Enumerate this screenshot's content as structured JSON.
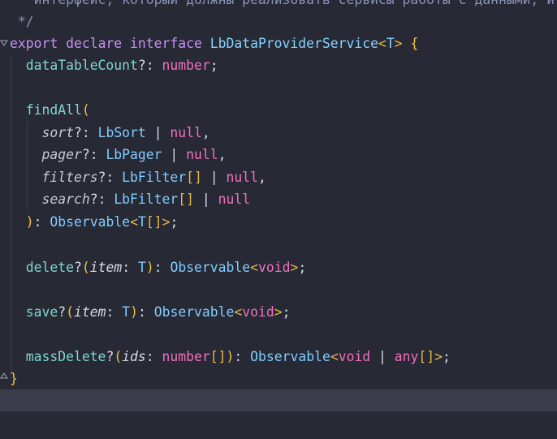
{
  "editor": {
    "lines": [
      {
        "t": "comment",
        "text": " * интерфейс, который должны реализовать сервисы работы с данными, и"
      },
      {
        "t": "comment",
        "text": " */"
      },
      {
        "t": "code",
        "parts": [
          [
            "kw",
            "export"
          ],
          [
            "punct",
            " "
          ],
          [
            "kw",
            "declare"
          ],
          [
            "punct",
            " "
          ],
          [
            "kw",
            "interface"
          ],
          [
            "punct",
            " "
          ],
          [
            "type",
            "LbDataProviderService"
          ],
          [
            "angle",
            "<"
          ],
          [
            "type",
            "T"
          ],
          [
            "angle",
            ">"
          ],
          [
            "punct",
            " "
          ],
          [
            "paren",
            "{"
          ]
        ]
      },
      {
        "t": "code",
        "parts": [
          [
            "punct",
            "  "
          ],
          [
            "fn",
            "dataTableCount"
          ],
          [
            "punct",
            "?: "
          ],
          [
            "num",
            "number"
          ],
          [
            "punct",
            ";"
          ]
        ]
      },
      {
        "t": "empty"
      },
      {
        "t": "code",
        "parts": [
          [
            "punct",
            "  "
          ],
          [
            "fn",
            "findAll"
          ],
          [
            "paren",
            "("
          ]
        ]
      },
      {
        "t": "code",
        "parts": [
          [
            "punct",
            "    "
          ],
          [
            "sortp",
            "sort"
          ],
          [
            "punct",
            "?: "
          ],
          [
            "typep",
            "LbSort"
          ],
          [
            "punct",
            " | "
          ],
          [
            "null",
            "null"
          ],
          [
            "punct",
            ","
          ]
        ]
      },
      {
        "t": "code",
        "parts": [
          [
            "punct",
            "    "
          ],
          [
            "sortp",
            "pager"
          ],
          [
            "punct",
            "?: "
          ],
          [
            "typep",
            "LbPager"
          ],
          [
            "punct",
            " | "
          ],
          [
            "null",
            "null"
          ],
          [
            "punct",
            ","
          ]
        ]
      },
      {
        "t": "code",
        "parts": [
          [
            "punct",
            "    "
          ],
          [
            "sortp",
            "filters"
          ],
          [
            "punct",
            "?: "
          ],
          [
            "typep",
            "LbFilter"
          ],
          [
            "angle",
            "[]"
          ],
          [
            "punct",
            " | "
          ],
          [
            "null",
            "null"
          ],
          [
            "punct",
            ","
          ]
        ]
      },
      {
        "t": "code",
        "parts": [
          [
            "punct",
            "    "
          ],
          [
            "sortp",
            "search"
          ],
          [
            "punct",
            "?: "
          ],
          [
            "typep",
            "LbFilter"
          ],
          [
            "angle",
            "[]"
          ],
          [
            "punct",
            " | "
          ],
          [
            "null",
            "null"
          ]
        ]
      },
      {
        "t": "code",
        "parts": [
          [
            "punct",
            "  "
          ],
          [
            "paren",
            ")"
          ],
          [
            "punct",
            ": "
          ],
          [
            "typep",
            "Observable"
          ],
          [
            "angle",
            "<"
          ],
          [
            "typep",
            "T"
          ],
          [
            "angle",
            "[]"
          ],
          [
            "angle",
            ">"
          ],
          [
            "punct",
            ";"
          ]
        ]
      },
      {
        "t": "empty"
      },
      {
        "t": "code",
        "parts": [
          [
            "punct",
            "  "
          ],
          [
            "fn",
            "delete"
          ],
          [
            "punct",
            "?"
          ],
          [
            "paren",
            "("
          ],
          [
            "param",
            "item"
          ],
          [
            "punct",
            ": "
          ],
          [
            "typep",
            "T"
          ],
          [
            "paren",
            ")"
          ],
          [
            "punct",
            ": "
          ],
          [
            "typep",
            "Observable"
          ],
          [
            "angle",
            "<"
          ],
          [
            "num",
            "void"
          ],
          [
            "angle",
            ">"
          ],
          [
            "punct",
            ";"
          ]
        ]
      },
      {
        "t": "empty"
      },
      {
        "t": "code",
        "parts": [
          [
            "punct",
            "  "
          ],
          [
            "fn",
            "save"
          ],
          [
            "punct",
            "?"
          ],
          [
            "paren",
            "("
          ],
          [
            "param",
            "item"
          ],
          [
            "punct",
            ": "
          ],
          [
            "typep",
            "T"
          ],
          [
            "paren",
            ")"
          ],
          [
            "punct",
            ": "
          ],
          [
            "typep",
            "Observable"
          ],
          [
            "angle",
            "<"
          ],
          [
            "num",
            "void"
          ],
          [
            "angle",
            ">"
          ],
          [
            "punct",
            ";"
          ]
        ]
      },
      {
        "t": "empty"
      },
      {
        "t": "code",
        "parts": [
          [
            "punct",
            "  "
          ],
          [
            "fn",
            "massDelete"
          ],
          [
            "punct",
            "?"
          ],
          [
            "paren",
            "("
          ],
          [
            "param",
            "ids"
          ],
          [
            "punct",
            ": "
          ],
          [
            "num",
            "number"
          ],
          [
            "angle",
            "[]"
          ],
          [
            "paren",
            ")"
          ],
          [
            "punct",
            ": "
          ],
          [
            "typep",
            "Observable"
          ],
          [
            "angle",
            "<"
          ],
          [
            "num",
            "void"
          ],
          [
            "punct",
            " | "
          ],
          [
            "num",
            "any"
          ],
          [
            "angle",
            "[]"
          ],
          [
            "angle",
            ">"
          ],
          [
            "punct",
            ";"
          ]
        ]
      },
      {
        "t": "code",
        "parts": [
          [
            "paren",
            "}"
          ]
        ]
      }
    ]
  }
}
